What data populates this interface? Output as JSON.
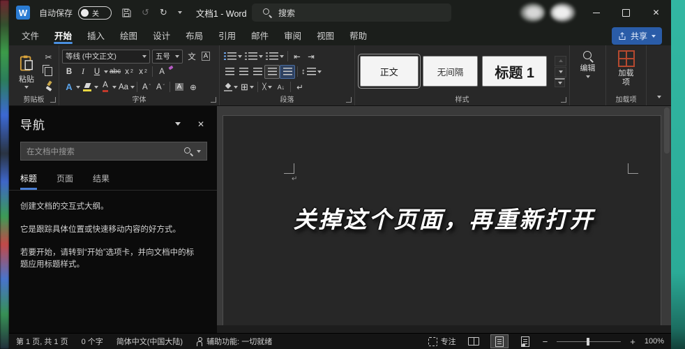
{
  "titlebar": {
    "app_logo": "W",
    "autosave_label": "自动保存",
    "autosave_state": "关",
    "document_title": "文档1 - Word",
    "search_label": "搜索"
  },
  "ribbon_tabs": {
    "items": [
      "文件",
      "开始",
      "插入",
      "绘图",
      "设计",
      "布局",
      "引用",
      "邮件",
      "审阅",
      "视图",
      "帮助"
    ],
    "active": "开始",
    "share_label": "共享"
  },
  "ribbon": {
    "clipboard": {
      "paste": "粘贴",
      "label": "剪贴板"
    },
    "font": {
      "name": "等线 (中文正文)",
      "size": "五号",
      "label": "字体"
    },
    "paragraph": {
      "label": "段落"
    },
    "styles": {
      "cards": [
        "正文",
        "无间隔",
        "标题 1"
      ],
      "label": "样式"
    },
    "editing": {
      "label": "编辑"
    },
    "addins": {
      "button": "加载项",
      "label": "加载项"
    }
  },
  "navpane": {
    "title": "导航",
    "search_placeholder": "在文档中搜索",
    "tabs": [
      "标题",
      "页面",
      "结果"
    ],
    "active_tab": "标题",
    "paragraphs": [
      "创建文档的交互式大纲。",
      "它是跟踪具体位置或快速移动内容的好方式。",
      "若要开始，请转到“开始”选项卡，并向文档中的标题应用标题样式。"
    ]
  },
  "document": {
    "caption": "关掉这个页面，再重新打开"
  },
  "statusbar": {
    "page_info": "第 1 页, 共 1 页",
    "word_count": "0 个字",
    "language": "简体中文(中国大陆)",
    "accessibility": "辅助功能: 一切就绪",
    "focus": "专注",
    "zoom": "100%"
  },
  "icons": {
    "close": "✕",
    "undo": "↺",
    "redo": "↻",
    "scissors": "✂",
    "bold": "B",
    "italic": "I",
    "underline": "U",
    "strikethrough": "abc",
    "sub_base": "x",
    "sub_mark": "2",
    "sup_base": "x",
    "sup_mark": "2",
    "clear_format": "A",
    "text_effects": "A",
    "font_color": "A",
    "change_case": "Aa",
    "grow_base": "A",
    "grow_mark": "ˆ",
    "shrink_base": "A",
    "shrink_mark": "ˇ",
    "char_border": "A",
    "char_shading": "A",
    "enclose": "⊕",
    "phonetic": "文",
    "indent_dec": "⇤",
    "indent_inc": "⇥",
    "line_spacing": "↕",
    "asian_layout": "╳",
    "borders": "⊞",
    "sort": "A↓",
    "para_marks": "↵",
    "pilcrow": "↵",
    "minus": "−",
    "plus": "+"
  },
  "colors": {
    "accent_blue": "#4a8fe0",
    "share_blue": "#2a5ca8",
    "teal_edge": "#2bb39e",
    "addins_red": "#b5492f",
    "highlight_yellow": "#e7d642",
    "font_color_red": "#c0392b"
  }
}
